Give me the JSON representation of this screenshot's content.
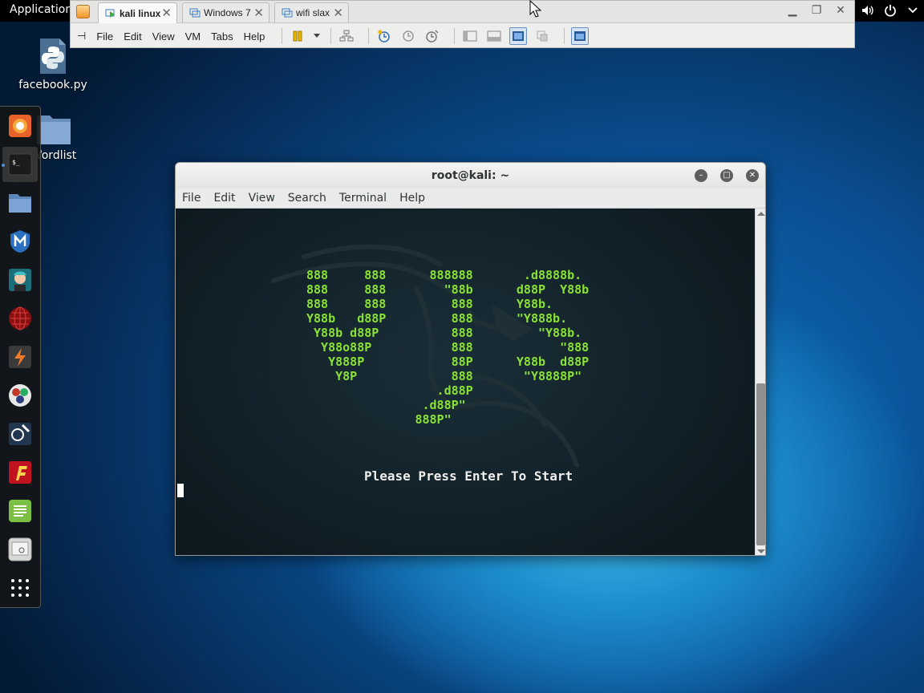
{
  "gnome_panel": {
    "applications_label": "Applications"
  },
  "vmware": {
    "tabs": [
      {
        "label": "kali linux",
        "active": true
      },
      {
        "label": "Windows 7",
        "active": false
      },
      {
        "label": "wifi slax",
        "active": false
      }
    ],
    "menu": [
      "File",
      "Edit",
      "View",
      "VM",
      "Tabs",
      "Help"
    ]
  },
  "desktop": {
    "icons": [
      {
        "label": "facebook.py",
        "icon": "python-file-icon"
      },
      {
        "label": "Wordlist",
        "icon": "folder-icon"
      }
    ]
  },
  "dock": {
    "items": [
      "firefox-icon",
      "terminal-icon",
      "files-icon",
      "metasploit-icon",
      "armitage-icon",
      "maltego-icon",
      "burpsuite-icon",
      "beef-icon",
      "faraday-icon",
      "leafpad-icon",
      "cutycapt-icon",
      "notes-icon",
      "show-apps-icon"
    ]
  },
  "terminal": {
    "title": "root@kali: ~",
    "menu": [
      "File",
      "Edit",
      "View",
      "Search",
      "Terminal",
      "Help"
    ],
    "banner": "888     888      888888       .d8888b.\n888     888        \"88b      d88P  Y88b\n888     888         888      Y88b.\nY88b   d88P         888      \"Y888b.\n Y88b d88P          888         \"Y88b.\n  Y88o88P           888            \"888\n   Y888P            88P      Y88b  d88P\n    Y8P             888       \"Y8888P\"\n                  .d88P\n                .d88P\"\n               888P\"",
    "prompt": "Please Press Enter To Start"
  },
  "colors": {
    "terminal_text": "#8ae234",
    "terminal_bg": "#13232b",
    "desktop_bg": "#0a4f92"
  }
}
